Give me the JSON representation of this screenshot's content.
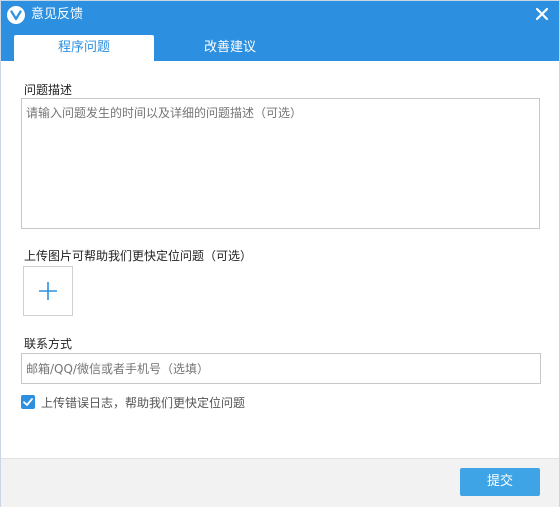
{
  "window": {
    "title": "意见反馈"
  },
  "tabs": [
    {
      "label": "程序问题",
      "active": true
    },
    {
      "label": "改善建议",
      "active": false
    }
  ],
  "form": {
    "description_label": "问题描述",
    "description_placeholder": "请输入问题发生的时间以及详细的问题描述（可选）",
    "upload_label": "上传图片可帮助我们更快定位问题（可选）",
    "contact_label": "联系方式",
    "contact_placeholder": "邮箱/QQ/微信或者手机号（选填）",
    "log_checkbox_label": "上传错误日志，帮助我们更快定位问题",
    "log_checkbox_checked": true
  },
  "footer": {
    "submit_label": "提交"
  },
  "icons": {
    "logo": "app-logo-icon",
    "close": "close-icon",
    "add": "plus-icon",
    "check": "checkmark-icon"
  },
  "colors": {
    "accent": "#2d8fe0",
    "button": "#3fa4e6"
  }
}
